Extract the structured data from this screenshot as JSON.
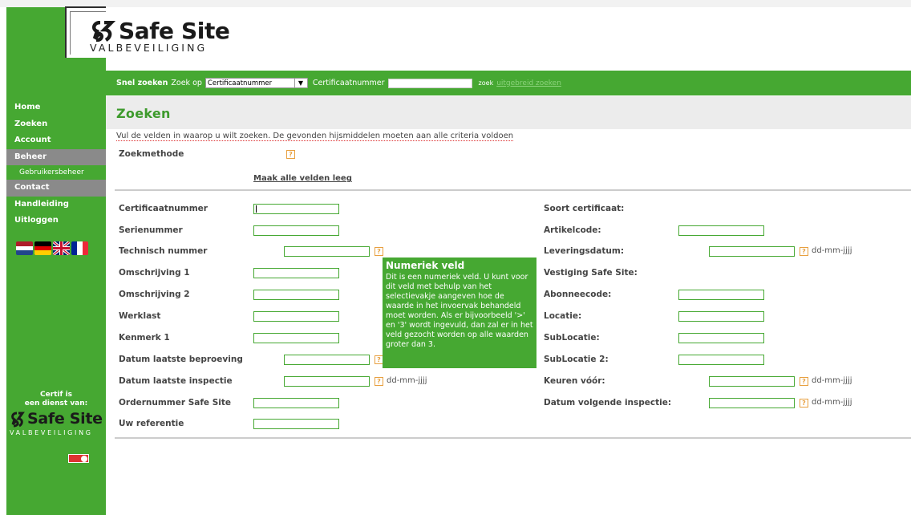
{
  "logo": {
    "name": "Safe Site",
    "tagline": "VALBEVEILIGING"
  },
  "quick_search": {
    "title": "Snel zoeken",
    "search_by_label": "Zoek op",
    "search_by_value": "Certificaatnummer",
    "field_label": "Certificaatnummer",
    "search_button": "zoek",
    "advanced_link": "uitgebreid zoeken"
  },
  "nav": {
    "items": [
      "Home",
      "Zoeken",
      "Account",
      "Beheer",
      "Gebruikersbeheer",
      "Contact",
      "Handleiding",
      "Uitloggen"
    ]
  },
  "sidebar_footer": {
    "line1": "Certif is",
    "line2": "een dienst van:",
    "logo_name": "Safe Site",
    "logo_tagline": "VALBEVEILIGING"
  },
  "page": {
    "title": "Zoeken",
    "intro": "Vul de velden in waarop u wilt zoeken. De gevonden hijsmiddelen moeten aan alle criteria voldoen",
    "search_method_label": "Zoekmethode",
    "clear_link": "Maak alle velden leeg"
  },
  "left_fields": [
    "Certificaatnummer",
    "Serienummer",
    "Technisch nummer",
    "Omschrijving 1",
    "Omschrijving 2",
    "Werklast",
    "Kenmerk 1",
    "Datum laatste beproeving",
    "Datum laatste inspectie",
    "Ordernummer Safe Site",
    "Uw referentie"
  ],
  "right_fields": [
    "Soort certificaat:",
    "Artikelcode:",
    "Leveringsdatum:",
    "Vestiging Safe Site:",
    "Abonneecode:",
    "Locatie:",
    "SubLocatie:",
    "SubLocatie 2:",
    "Keuren vóór:",
    "Datum volgende inspectie:"
  ],
  "help_glyph": "?",
  "date_format": "dd-mm-jjjj",
  "tooltip": {
    "title": "Numeriek veld",
    "body": "Dit is een numeriek veld. U kunt voor dit veld met behulp van het selectievakje aangeven hoe de waarde in het invoervak behandeld moet worden. Als er bijvoorbeeld '>' en '3' wordt ingevuld, dan zal er in het veld gezocht worden op alle waarden groter dan 3."
  },
  "colors": {
    "brand_green": "#46a832",
    "nav_active": "#8a8a8a",
    "title_green": "#3d9a2c",
    "help_orange": "#e8a040"
  }
}
